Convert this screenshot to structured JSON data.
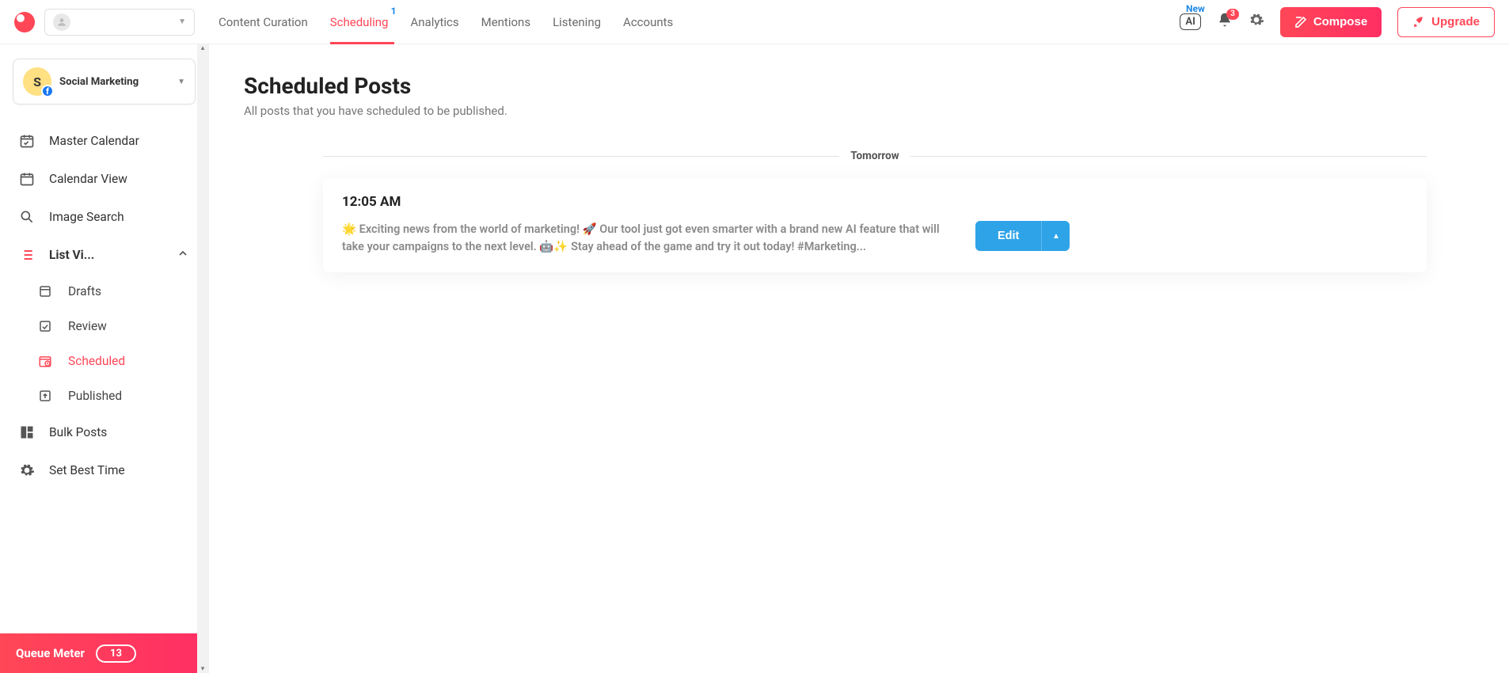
{
  "nav": {
    "links": [
      "Content Curation",
      "Scheduling",
      "Analytics",
      "Mentions",
      "Listening",
      "Accounts"
    ],
    "active_index": 1,
    "scheduling_badge": "1",
    "ai_label": "AI",
    "ai_new": "New",
    "bell_badge": "3",
    "compose": "Compose",
    "upgrade": "Upgrade"
  },
  "sidebar": {
    "profile": {
      "initial": "S",
      "name": "Social Marketing"
    },
    "items": {
      "master": "Master Calendar",
      "calview": "Calendar View",
      "imgsearch": "Image Search",
      "listview": "List Vi...",
      "bulk": "Bulk Posts",
      "besttime": "Set Best Time"
    },
    "sub": {
      "drafts": "Drafts",
      "review": "Review",
      "scheduled": "Scheduled",
      "published": "Published"
    },
    "queue": {
      "label": "Queue Meter",
      "count": "13"
    }
  },
  "page": {
    "title": "Scheduled Posts",
    "subtitle": "All posts that you have scheduled to be published.",
    "group_label": "Tomorrow",
    "post": {
      "time": "12:05 AM",
      "text": "🌟 Exciting news from the world of marketing! 🚀 Our tool just got even smarter with a brand new AI feature that will take your campaigns to the next level. 🤖✨ Stay ahead of the game and try it out today! #Marketing...",
      "edit": "Edit"
    }
  }
}
